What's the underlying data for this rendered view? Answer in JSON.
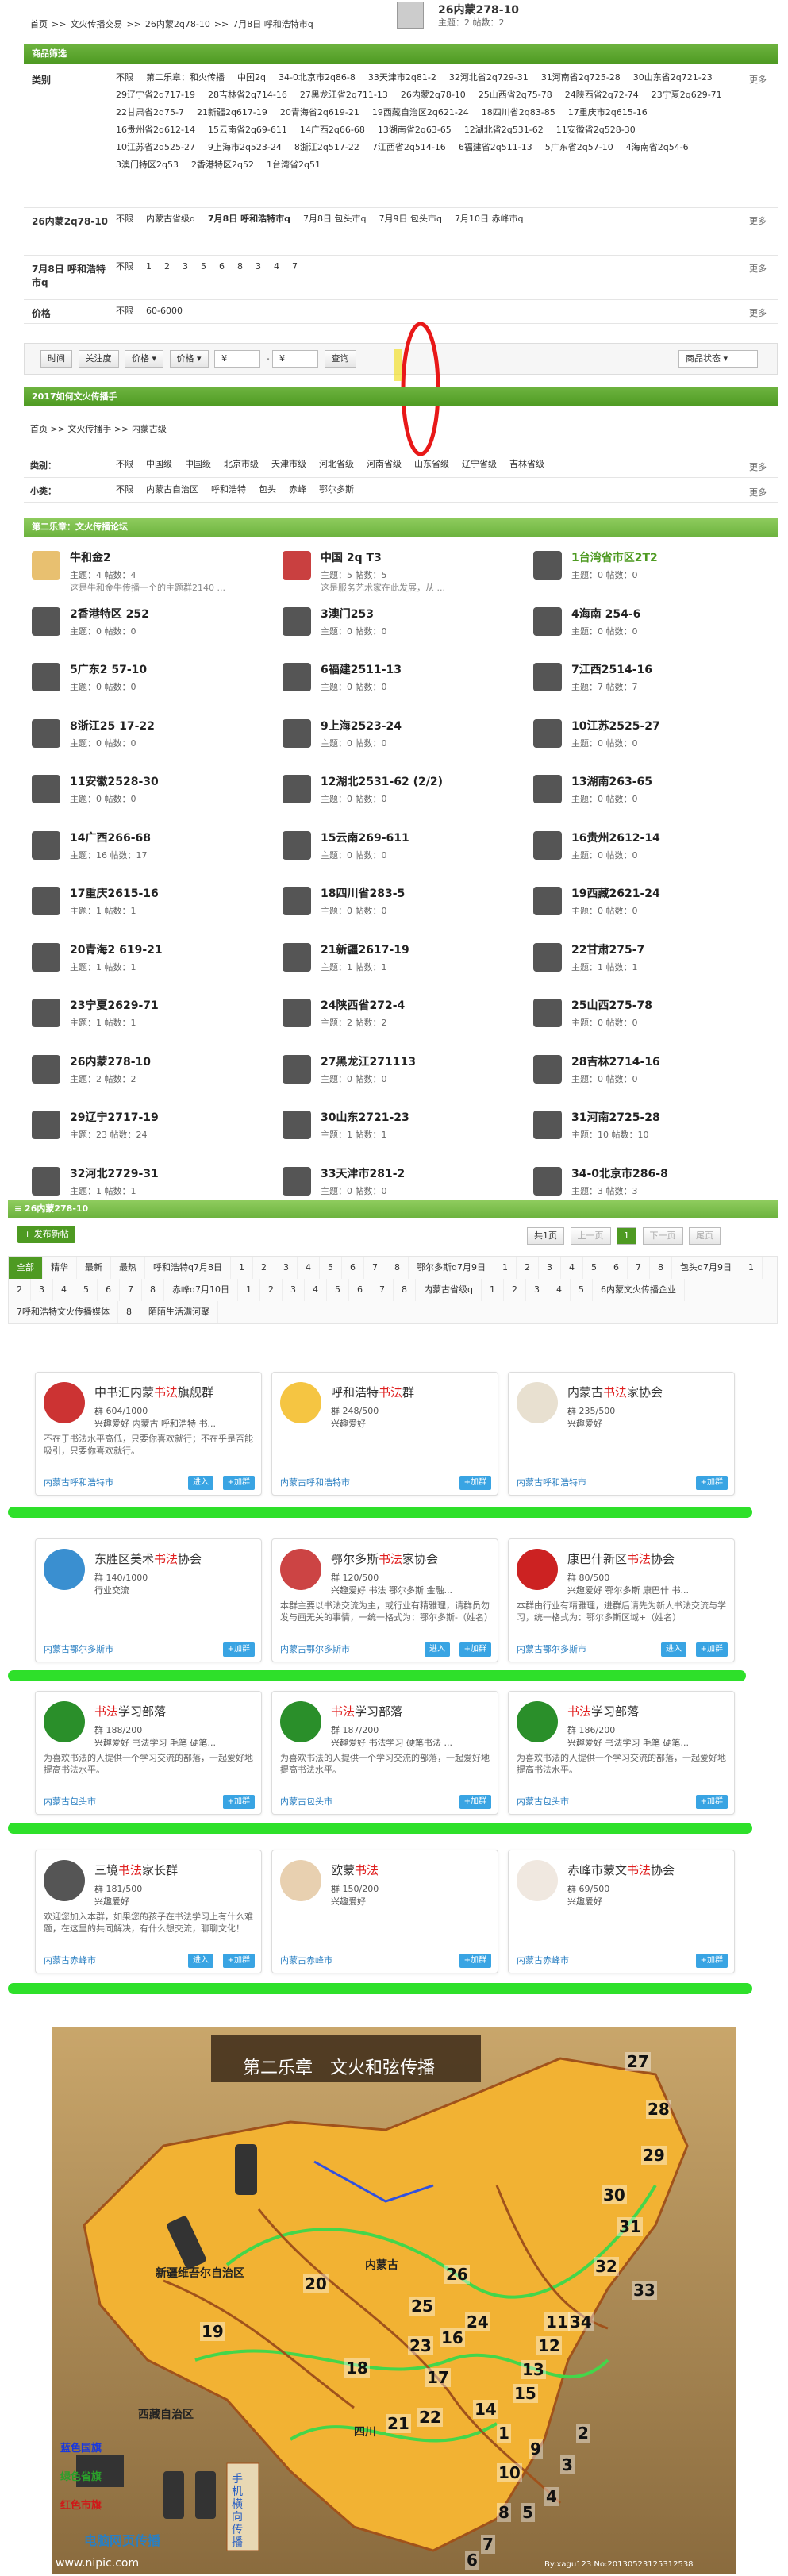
{
  "header": {
    "breadcrumb": [
      "首页",
      ">>",
      "文火传播交易",
      ">>",
      "26内蒙2q78-10",
      ">>",
      "7月8日 呼和浩特市q"
    ],
    "title": "26内蒙278-10",
    "stats": "主题：2 帖数：2"
  },
  "filter": {
    "title": "商品筛选",
    "more": "更多",
    "rows": [
      {
        "label": "类别",
        "items": [
          "不限",
          "第二乐章：和火传播",
          "中国2q",
          "34-0北京市2q86-8",
          "33天津市2q81-2",
          "32河北省2q729-31",
          "31河南省2q725-28",
          "30山东省2q721-23",
          "29辽宁省2q717-19",
          "28吉林省2q714-16",
          "27黑龙江省2q711-13",
          "26内蒙2q78-10",
          "25山西省2q75-78",
          "24陕西省2q72-74",
          "23宁夏2q629-71",
          "22甘肃省2q75-7",
          "21新疆2q617-19",
          "20青海省2q619-21",
          "19西藏自治区2q621-24",
          "18四川省2q83-85",
          "17重庆市2q615-16",
          "16贵州省2q612-14",
          "15云南省2q69-611",
          "14广西2q66-68",
          "13湖南省2q63-65",
          "12湖北省2q531-62",
          "11安徽省2q528-30",
          "10江苏省2q525-27",
          "9上海市2q523-24",
          "8浙江2q517-22",
          "7江西省2q514-16",
          "6福建省2q511-13",
          "5广东省2q57-10",
          "4海南省2q54-6",
          "3澳门特区2q53",
          "2香港特区2q52",
          "1台湾省2q51"
        ]
      },
      {
        "label": "26内蒙2q78-10",
        "items": [
          "不限",
          "内蒙古省级q",
          "7月8日 呼和浩特市q",
          "7月8日 包头市q",
          "7月9日 包头市q",
          "7月10日 赤峰市q"
        ]
      },
      {
        "label": "7月8日 呼和浩特市q",
        "items": [
          "不限",
          "1",
          "2",
          "3",
          "5",
          "6",
          "8",
          "3",
          "4",
          "7"
        ]
      },
      {
        "label": "价格",
        "items": [
          "不限",
          "60-6000"
        ]
      }
    ]
  },
  "toolbar": {
    "time": "时间",
    "attention": "关注度",
    "price1": "价格",
    "price2": "价格",
    "yen1": "¥",
    "dash": "-",
    "yen2": "¥",
    "query": "查询",
    "status": "商品状态"
  },
  "section2": {
    "title": "2017如何文火传播手",
    "breadcrumb": "首页 >> 文火传播手 >> 内蒙古级",
    "cat_label": "类别：",
    "cats": [
      "不限",
      "中国级",
      "中国级",
      "北京市级",
      "天津市级",
      "河北省级",
      "河南省级",
      "山东省级",
      "辽宁省级",
      "吉林省级"
    ],
    "sub_label": "小类：",
    "subs": [
      "不限",
      "内蒙古自治区",
      "呼和浩特",
      "包头",
      "赤峰",
      "鄂尔多斯"
    ]
  },
  "forums": {
    "title": "第二乐章：文火传播论坛",
    "items": [
      {
        "t": "牛和金2",
        "m": "主题：4 帖数：4",
        "s": "这是牛和金牛传播一个的主题群2140 ..."
      },
      {
        "t": "中国 2q T3",
        "m": "主题：5 帖数：5",
        "s": "这是服务艺术家在此发展，从 ..."
      },
      {
        "t": "1台湾省市区2T2",
        "m": "主题：0 帖数：0",
        "s": ""
      },
      {
        "t": "2香港特区 252",
        "m": "主题：0 帖数：0",
        "s": ""
      },
      {
        "t": "3澳门253",
        "m": "主题：0 帖数：0",
        "s": ""
      },
      {
        "t": "4海南 254-6",
        "m": "主题：0 帖数：0",
        "s": ""
      },
      {
        "t": "5广东2 57-10",
        "m": "主题：0 帖数：0",
        "s": ""
      },
      {
        "t": "6福建2511-13",
        "m": "主题：0 帖数：0",
        "s": ""
      },
      {
        "t": "7江西2514-16",
        "m": "主题：7 帖数：7",
        "s": ""
      },
      {
        "t": "8浙江25 17-22",
        "m": "主题：0 帖数：0",
        "s": ""
      },
      {
        "t": "9上海2523-24",
        "m": "主题：0 帖数：0",
        "s": ""
      },
      {
        "t": "10江苏2525-27",
        "m": "主题：0 帖数：0",
        "s": ""
      },
      {
        "t": "11安徽2528-30",
        "m": "主题：0 帖数：0",
        "s": ""
      },
      {
        "t": "12湖北2531-62 (2/2)",
        "m": "主题：0 帖数：0",
        "s": ""
      },
      {
        "t": "13湖南263-65",
        "m": "主题：0 帖数：0",
        "s": ""
      },
      {
        "t": "14广西266-68",
        "m": "主题：16 帖数：17",
        "s": ""
      },
      {
        "t": "15云南269-611",
        "m": "主题：0 帖数：0",
        "s": ""
      },
      {
        "t": "16贵州2612-14",
        "m": "主题：0 帖数：0",
        "s": ""
      },
      {
        "t": "17重庆2615-16",
        "m": "主题：1 帖数：1",
        "s": ""
      },
      {
        "t": "18四川省283-5",
        "m": "主题：0 帖数：0",
        "s": ""
      },
      {
        "t": "19西藏2621-24",
        "m": "主题：0 帖数：0",
        "s": ""
      },
      {
        "t": "20青海2 619-21",
        "m": "主题：1 帖数：1",
        "s": ""
      },
      {
        "t": "21新疆2617-19",
        "m": "主题：1 帖数：1",
        "s": ""
      },
      {
        "t": "22甘肃275-7",
        "m": "主题：1 帖数：1",
        "s": ""
      },
      {
        "t": "23宁夏2629-71",
        "m": "主题：1 帖数：1",
        "s": ""
      },
      {
        "t": "24陕西省272-4",
        "m": "主题：2 帖数：2",
        "s": ""
      },
      {
        "t": "25山西275-78",
        "m": "主题：0 帖数：0",
        "s": ""
      },
      {
        "t": "26内蒙278-10",
        "m": "主题：2 帖数：2",
        "s": ""
      },
      {
        "t": "27黑龙江271113",
        "m": "主题：0 帖数：0",
        "s": ""
      },
      {
        "t": "28吉林2714-16",
        "m": "主题：0 帖数：0",
        "s": ""
      },
      {
        "t": "29辽宁2717-19",
        "m": "主题：23 帖数：24",
        "s": ""
      },
      {
        "t": "30山东2721-23",
        "m": "主题：1 帖数：1",
        "s": ""
      },
      {
        "t": "31河南2725-28",
        "m": "主题：10 帖数：10",
        "s": ""
      },
      {
        "t": "32河北2729-31",
        "m": "主题：1 帖数：1",
        "s": ""
      },
      {
        "t": "33天津市281-2",
        "m": "主题：0 帖数：0",
        "s": ""
      },
      {
        "t": "34-0北京市286-8",
        "m": "主题：3 帖数：3",
        "s": ""
      }
    ]
  },
  "board": {
    "title": "26内蒙278-10",
    "post": "+ 发布新帖",
    "pages": "共1页",
    "prev": "上一页",
    "page": "1",
    "next": "下一页",
    "end": "尾页",
    "tabs": [
      "全部",
      "精华",
      "最新",
      "最热",
      "呼和浩特q7月8日",
      "1",
      "2",
      "3",
      "4",
      "5",
      "6",
      "7",
      "8",
      "鄂尔多斯q7月9日",
      "1",
      "2",
      "3",
      "4",
      "5",
      "6",
      "7",
      "8",
      "包头q7月9日",
      "1",
      "2",
      "3",
      "4",
      "5",
      "6",
      "7",
      "8",
      "赤峰q7月10日",
      "1",
      "2",
      "3",
      "4",
      "5",
      "6",
      "7",
      "8",
      "内蒙古省级q",
      "1",
      "2",
      "3",
      "4",
      "5",
      "6内蒙文火传播企业",
      "7呼和浩特文火传播媒体",
      "8",
      "陌陌生活满河聚"
    ]
  },
  "cards": [
    {
      "n1": "中书汇内蒙",
      "k": "书法",
      "n2": "旗舰群",
      "m1": "群 604/1000",
      "m2": "兴趣爱好 内蒙古 呼和浩特 书...",
      "d": "不在于书法水平高低，只要你喜欢就行；不在乎是否能吸引，只要你喜欢就行。",
      "loc": "内蒙古呼和浩特市",
      "b1": "进入",
      "b2": "+加群"
    },
    {
      "n1": "呼和浩特",
      "k": "书法",
      "n2": "群",
      "m1": "群 248/500",
      "m2": "兴趣爱好",
      "d": "",
      "loc": "内蒙古呼和浩特市",
      "b1": "",
      "b2": "+加群"
    },
    {
      "n1": "内蒙古",
      "k": "书法",
      "n2": "家协会",
      "m1": "群 235/500",
      "m2": "兴趣爱好",
      "d": "",
      "loc": "内蒙古呼和浩特市",
      "b1": "",
      "b2": "+加群"
    },
    {
      "n1": "东胜区美术",
      "k": "书法",
      "n2": "协会",
      "m1": "群 140/1000",
      "m2": "行业交流",
      "d": "",
      "loc": "内蒙古鄂尔多斯市",
      "b1": "",
      "b2": "+加群"
    },
    {
      "n1": "鄂尔多斯",
      "k": "书法",
      "n2": "家协会",
      "m1": "群 120/500",
      "m2": "兴趣爱好 书法 鄂尔多斯 金融...",
      "d": "本群主要以书法交流为主，或行业有精雅理，请群员勿发与画无关的事情，一统一格式为：鄂尔多斯-（姓名）",
      "loc": "内蒙古鄂尔多斯市",
      "b1": "进入",
      "b2": "+加群"
    },
    {
      "n1": "康巴什新区",
      "k": "书法",
      "n2": "协会",
      "m1": "群 80/500",
      "m2": "兴趣爱好 鄂尔多斯 康巴什 书...",
      "d": "本群由行业有精雅理，进群后请先为新人书法交流与学习，统一格式为：鄂尔多斯区域+（姓名）",
      "loc": "内蒙古鄂尔多斯市",
      "b1": "进入",
      "b2": "+加群"
    },
    {
      "n1": "",
      "k": "书法",
      "n2": "学习部落",
      "m1": "群 188/200",
      "m2": "兴趣爱好 书法学习 毛笔 硬笔...",
      "d": "为喜欢书法的人提供一个学习交流的部落，一起爱好地提高书法水平。",
      "loc": "内蒙古包头市",
      "b1": "",
      "b2": "+加群"
    },
    {
      "n1": "",
      "k": "书法",
      "n2": "学习部落",
      "m1": "群 187/200",
      "m2": "兴趣爱好 书法学习 硬笔书法 ...",
      "d": "为喜欢书法的人提供一个学习交流的部落，一起爱好地提高书法水平。",
      "loc": "内蒙古包头市",
      "b1": "",
      "b2": "+加群"
    },
    {
      "n1": "",
      "k": "书法",
      "n2": "学习部落",
      "m1": "群 186/200",
      "m2": "兴趣爱好 书法学习 毛笔 硬笔...",
      "d": "为喜欢书法的人提供一个学习交流的部落，一起爱好地提高书法水平。",
      "loc": "内蒙古包头市",
      "b1": "",
      "b2": "+加群"
    },
    {
      "n1": "三境",
      "k": "书法",
      "n2": "家长群",
      "m1": "群 181/500",
      "m2": "兴趣爱好",
      "d": "欢迎您加入本群，如果您的孩子在书法学习上有什么难题，在这里的共同解决，有什么想交流，聊聊文化！",
      "loc": "内蒙古赤峰市",
      "b1": "进入",
      "b2": "+加群"
    },
    {
      "n1": "欧蒙",
      "k": "书法",
      "n2": "",
      "m1": "群 150/200",
      "m2": "兴趣爱好",
      "d": "",
      "loc": "内蒙古赤峰市",
      "b1": "",
      "b2": "+加群"
    },
    {
      "n1": "赤峰市蒙文",
      "k": "书法",
      "n2": "协会",
      "m1": "群 69/500",
      "m2": "兴趣爱好",
      "d": "",
      "loc": "内蒙古赤峰市",
      "b1": "",
      "b2": "+加群"
    }
  ],
  "map": {
    "banner": "第二乐章　文火和弦传播",
    "legend": [
      "蓝色国旗",
      "绿色省旗",
      "红色市旗"
    ],
    "footer": "电脑网页传播",
    "vertical": "手机横向传播",
    "watermark": "www.nipic.com",
    "credit": "By:xagu123 No:20130523125312538",
    "numbers": [
      "27",
      "28",
      "29",
      "30",
      "31",
      "32",
      "33",
      "34",
      "20",
      "19",
      "18",
      "17",
      "16",
      "26",
      "25",
      "23",
      "24",
      "21",
      "22",
      "14",
      "15",
      "13",
      "12",
      "11",
      "10",
      "9",
      "8",
      "7",
      "6",
      "5",
      "4",
      "3",
      "2",
      "1"
    ],
    "labels": [
      "新疆维吾尔自治区",
      "西藏自治区",
      "内蒙古",
      "四川"
    ]
  }
}
